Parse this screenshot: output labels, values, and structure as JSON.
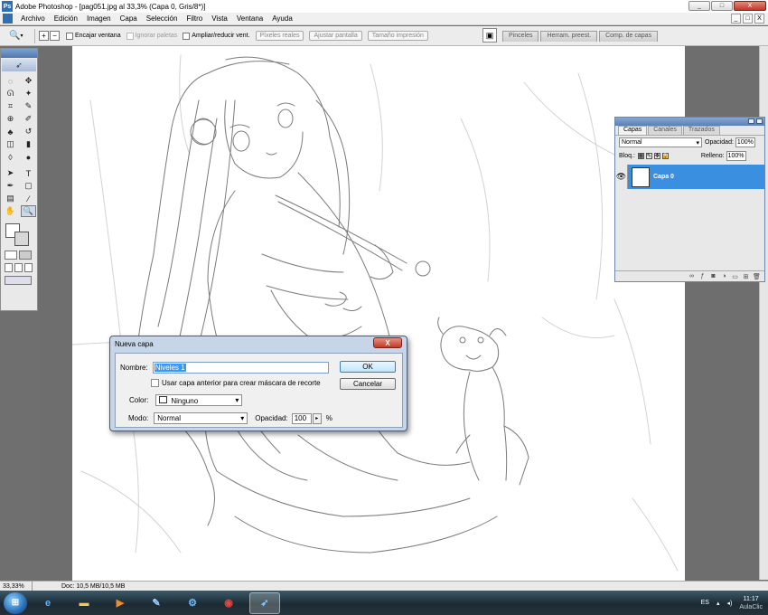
{
  "window": {
    "title": "Adobe Photoshop - [pag051.jpg al 33,3% (Capa 0, Gris/8*)]",
    "controls": [
      "_",
      "□",
      "X"
    ],
    "doc_controls": [
      "_",
      "□",
      "X"
    ]
  },
  "menu": {
    "items": [
      "Archivo",
      "Edición",
      "Imagen",
      "Capa",
      "Selección",
      "Filtro",
      "Vista",
      "Ventana",
      "Ayuda"
    ]
  },
  "options_bar": {
    "checkbox1": "Encajar ventana",
    "checkbox2": "Ignorar paletas",
    "checkbox3": "Ampliar/reducir vent.",
    "button1": "Píxeles reales",
    "button2": "Ajustar pantalla",
    "button3": "Tamaño impresión",
    "well_tabs": [
      "Pinceles",
      "Herram. preest.",
      "Comp. de capas"
    ]
  },
  "layers_panel": {
    "tabs": [
      "Capas",
      "Canales",
      "Trazados"
    ],
    "blend_mode": "Normal",
    "opacity_label": "Opacidad:",
    "opacity_value": "100%",
    "lock_label": "Bloq.:",
    "fill_label": "Relleno:",
    "fill_value": "100%",
    "layer_name": "Capa 0"
  },
  "dialog": {
    "title": "Nueva capa",
    "name_label": "Nombre:",
    "name_value": "Niveles 1",
    "clipping_label": "Usar capa anterior para crear máscara de recorte",
    "color_label": "Color:",
    "color_value": "Ninguno",
    "mode_label": "Modo:",
    "mode_value": "Normal",
    "opacity_label": "Opacidad:",
    "opacity_value": "100",
    "opacity_unit": "%",
    "ok_label": "OK",
    "cancel_label": "Cancelar",
    "close_label": "X"
  },
  "status": {
    "zoom": "33,33%",
    "doc": "Doc: 10,5 MB/10,5 MB"
  },
  "taskbar": {
    "lang": "ES",
    "time": "11:17",
    "watermark": "AulaClic"
  }
}
